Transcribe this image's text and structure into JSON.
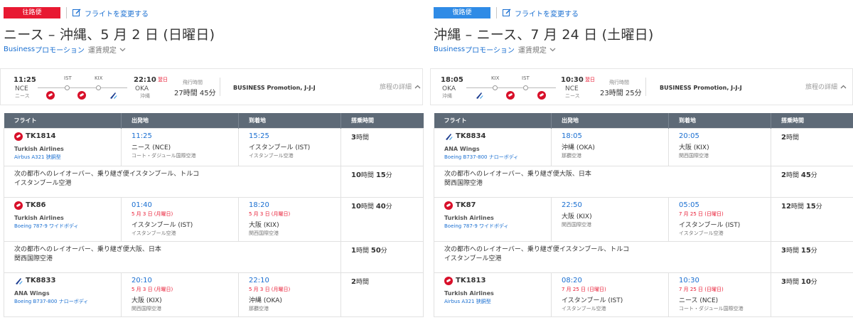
{
  "outbound": {
    "badge": "往路便",
    "change_label": "フライトを変更する",
    "title": "ニース – 沖縄、5 月 2 日 (日曜日)",
    "fare_biz": "Business",
    "fare_promo": "プロモーション",
    "fare_rules": "運賃規定",
    "summary": {
      "dep_time": "11:25",
      "dep_code": "NCE",
      "dep_city": "ニース",
      "stop1": "IST",
      "stop2": "KIX",
      "arr_time": "22:10",
      "arr_code": "OKA",
      "arr_city": "沖縄",
      "next_day": "翌日",
      "duration_label": "飛行時間",
      "duration": "27時間 45分",
      "fare_class": "BUSINESS Promotion, J-J-J",
      "details": "旅程の詳細"
    },
    "headers": [
      "フライト",
      "出発地",
      "到着地",
      "搭乗時間"
    ],
    "legs": [
      {
        "flight": "TK1814",
        "airline": "Turkish Airlines",
        "aircraft": "Airbus A321 狭胴型",
        "logo": "tk",
        "dep_time": "11:25",
        "dep_date": "",
        "dep_city": "ニース (NCE)",
        "dep_apt": "コート・ダジュール国際空港",
        "arr_time": "15:25",
        "arr_date": "",
        "arr_city": "イスタンブール (IST)",
        "arr_apt": "イスタンブール空港",
        "elapsed_h": "3",
        "elapsed_hu": "時間",
        "elapsed_m": "",
        "elapsed_mu": ""
      },
      {
        "flight": "TK86",
        "airline": "Turkish Airlines",
        "aircraft": "Boeing 787-9 ワイドボディ",
        "logo": "tk",
        "dep_time": "01:40",
        "dep_date": "5 月 3 日 (月曜日)",
        "dep_city": "イスタンブール (IST)",
        "dep_apt": "イスタンブール空港",
        "arr_time": "18:20",
        "arr_date": "5 月 3 日 (月曜日)",
        "arr_city": "大阪 (KIX)",
        "arr_apt": "関西国際空港",
        "elapsed_h": "10",
        "elapsed_hu": "時間",
        "elapsed_m": "40",
        "elapsed_mu": "分"
      },
      {
        "flight": "TK8833",
        "airline": "ANA Wings",
        "aircraft": "Boeing B737-800 ナローボディ",
        "logo": "ana",
        "dep_time": "20:10",
        "dep_date": "5 月 3 日 (月曜日)",
        "dep_city": "大阪 (KIX)",
        "dep_apt": "関西国際空港",
        "arr_time": "22:10",
        "arr_date": "5 月 3 日 (月曜日)",
        "arr_city": "沖縄 (OKA)",
        "arr_apt": "那覇空港",
        "elapsed_h": "2",
        "elapsed_hu": "時間",
        "elapsed_m": "",
        "elapsed_mu": ""
      }
    ],
    "layovers": [
      {
        "line1": "次の都市へのレイオーバー、乗り継ぎ便イスタンブール、トルコ",
        "line2": "イスタンブール空港",
        "h": "10",
        "hu": "時間",
        "m": "15",
        "mu": "分"
      },
      {
        "line1": "次の都市へのレイオーバー、乗り継ぎ便大阪、日本",
        "line2": "関西国際空港",
        "h": "1",
        "hu": "時間",
        "m": "50",
        "mu": "分"
      }
    ]
  },
  "inbound": {
    "badge": "復路便",
    "change_label": "フライトを変更する",
    "title": "沖縄 – ニース、7 月 24 日 (土曜日)",
    "fare_biz": "Business",
    "fare_promo": "プロモーション",
    "fare_rules": "運賃規定",
    "summary": {
      "dep_time": "18:05",
      "dep_code": "OKA",
      "dep_city": "沖縄",
      "stop1": "KIX",
      "stop2": "IST",
      "arr_time": "10:30",
      "arr_code": "NCE",
      "arr_city": "ニース",
      "next_day": "翌日",
      "duration_label": "飛行時間",
      "duration": "23時間 25分",
      "fare_class": "BUSINESS Promotion, J-J-J",
      "details": "旅程の詳細"
    },
    "headers": [
      "フライト",
      "出発地",
      "到着地",
      "搭乗時間"
    ],
    "legs": [
      {
        "flight": "TK8834",
        "airline": "ANA Wings",
        "aircraft": "Boeing B737-800 ナローボディ",
        "logo": "ana",
        "dep_time": "18:05",
        "dep_date": "",
        "dep_city": "沖縄 (OKA)",
        "dep_apt": "那覇空港",
        "arr_time": "20:05",
        "arr_date": "",
        "arr_city": "大阪 (KIX)",
        "arr_apt": "関西国際空港",
        "elapsed_h": "2",
        "elapsed_hu": "時間",
        "elapsed_m": "",
        "elapsed_mu": ""
      },
      {
        "flight": "TK87",
        "airline": "Turkish Airlines",
        "aircraft": "Boeing 787-9 ワイドボディ",
        "logo": "tk",
        "dep_time": "22:50",
        "dep_date": "",
        "dep_city": "大阪 (KIX)",
        "dep_apt": "関西国際空港",
        "arr_time": "05:05",
        "arr_date": "7 月 25 日 (日曜日)",
        "arr_city": "イスタンブール (IST)",
        "arr_apt": "イスタンブール空港",
        "elapsed_h": "12",
        "elapsed_hu": "時間",
        "elapsed_m": "15",
        "elapsed_mu": "分"
      },
      {
        "flight": "TK1813",
        "airline": "Turkish Airlines",
        "aircraft": "Airbus A321 狭胴型",
        "logo": "tk",
        "dep_time": "08:20",
        "dep_date": "7 月 25 日 (日曜日)",
        "dep_city": "イスタンブール (IST)",
        "dep_apt": "イスタンブール空港",
        "arr_time": "10:30",
        "arr_date": "7 月 25 日 (日曜日)",
        "arr_city": "ニース (NCE)",
        "arr_apt": "コート・ダジュール国際空港",
        "elapsed_h": "3",
        "elapsed_hu": "時間",
        "elapsed_m": "10",
        "elapsed_mu": "分"
      }
    ],
    "layovers": [
      {
        "line1": "次の都市へのレイオーバー、乗り継ぎ便大阪、日本",
        "line2": "関西国際空港",
        "h": "2",
        "hu": "時間",
        "m": "45",
        "mu": "分"
      },
      {
        "line1": "次の都市へのレイオーバー、乗り継ぎ便イスタンブール、トルコ",
        "line2": "イスタンブール空港",
        "h": "3",
        "hu": "時間",
        "m": "15",
        "mu": "分"
      }
    ]
  },
  "colors": {
    "badge_out": "#e81932",
    "badge_in": "#2f8be6",
    "link": "#1a6fd1",
    "header": "#5e6a77",
    "tk_red": "#d8102a",
    "ana_blue": "#1b3b8f"
  }
}
